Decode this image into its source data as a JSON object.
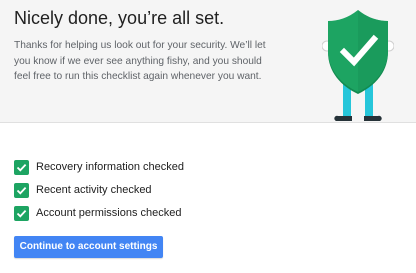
{
  "header": {
    "title": "Nicely done, you’re all set.",
    "description_lines": [
      "Thanks for helping us look out for your security. We’ll let",
      "you know if we ever see anything fishy, and you should",
      "feel free to run this checklist again whenever you want."
    ],
    "mascot_icon": "shield-checkmark-icon"
  },
  "checklist": {
    "check_icon": "checkmark-icon",
    "items": [
      {
        "label": "Recovery information checked",
        "checked": true
      },
      {
        "label": "Recent activity checked",
        "checked": true
      },
      {
        "label": "Account permissions checked",
        "checked": true
      }
    ]
  },
  "actions": {
    "continue_label": "Continue to account settings"
  },
  "colors": {
    "header_bg": "#f5f5f5",
    "shield_green": "#1da462",
    "check_green": "#1da462",
    "legs_teal": "#26c6da",
    "button_blue": "#4285f4"
  }
}
